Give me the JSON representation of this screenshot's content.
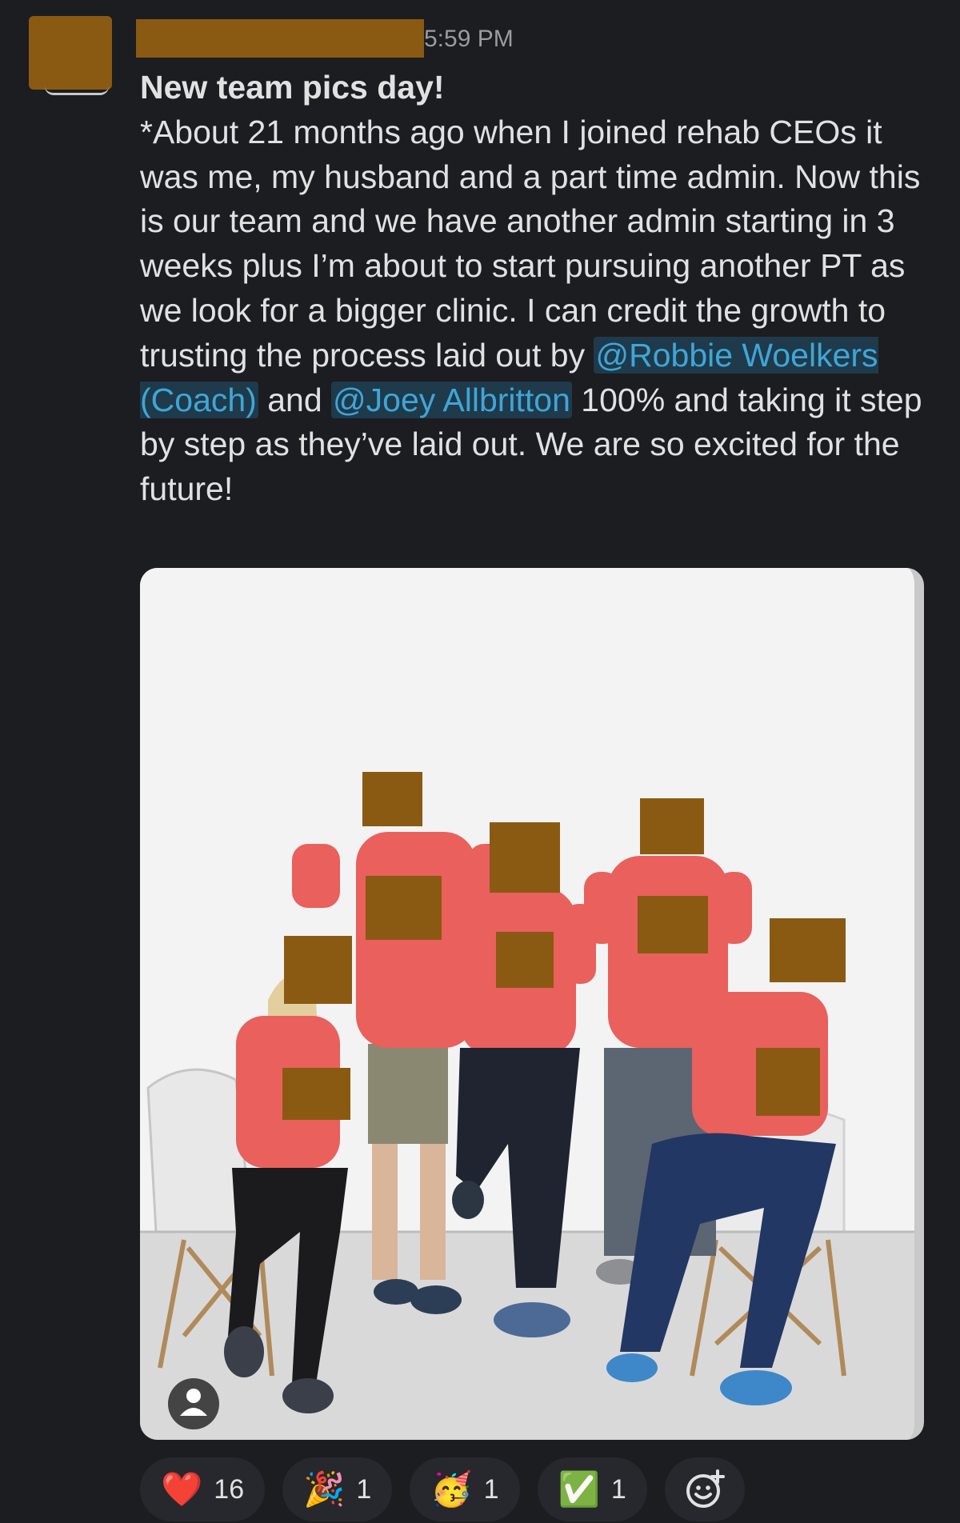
{
  "message": {
    "time": "5:59 PM",
    "headline": "New team pics day!",
    "body_1": "*About 21 months ago when I joined rehab CEOs it was me, my husband and a part time admin. Now this is our team and we have another admin starting in 3 weeks plus I’m about to start pursuing another PT as we look for a bigger clinic. I can credit the growth to trusting the process laid out by ",
    "mention_1": "@Robbie Woelkers (Coach)",
    "body_2": " and ",
    "mention_2": "@Joey Allbritton",
    "body_3": " 100% and taking it step by step as they’ve laid out. We are so excited for the future!"
  },
  "reactions": [
    {
      "emoji": "❤️",
      "icon": "heart-icon",
      "count": "16"
    },
    {
      "emoji": "🎉",
      "icon": "party-popper-icon",
      "count": "1"
    },
    {
      "emoji": "🥳",
      "icon": "partying-face-icon",
      "count": "1"
    },
    {
      "emoji": "✅",
      "icon": "check-mark-icon",
      "count": "1"
    }
  ],
  "colors": {
    "background": "#1b1d21",
    "mention": "#3ea6d9",
    "redaction": "#8b5a12",
    "shirt": "#e9605d"
  }
}
